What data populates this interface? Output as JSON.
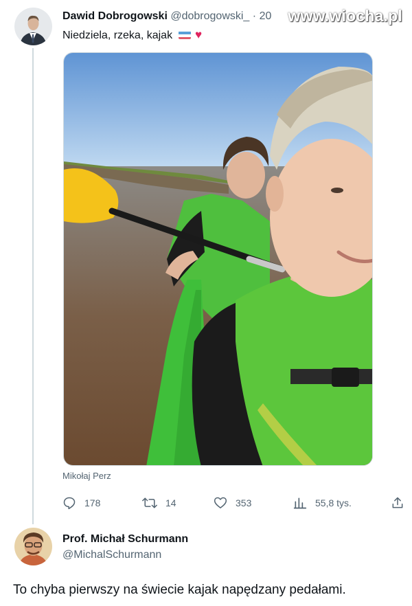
{
  "tweet": {
    "author_name": "Dawid Dobrogowski",
    "author_handle": "@dobrogowski_",
    "separator": "·",
    "date": "20",
    "text": "Niedziela, rzeka, kajak",
    "flag_icon": "flag-icon",
    "heart_glyph": "♥",
    "photo_credit": "Mikołaj Perz",
    "stats": {
      "replies": "178",
      "retweets": "14",
      "likes": "353",
      "views": "55,8 tys."
    }
  },
  "watermark": "www.wiocha.pl",
  "reply": {
    "author_name": "Prof. Michał Schurmann",
    "author_handle": "@MichalSchurmann",
    "text": "To chyba pierwszy na świecie kajak napędzany pedałami."
  },
  "colors": {
    "text_primary": "#0f1419",
    "text_secondary": "#536471",
    "heart": "#e0245e",
    "kayak_green": "#3fbf3a",
    "vest_green": "#5cc63c"
  }
}
